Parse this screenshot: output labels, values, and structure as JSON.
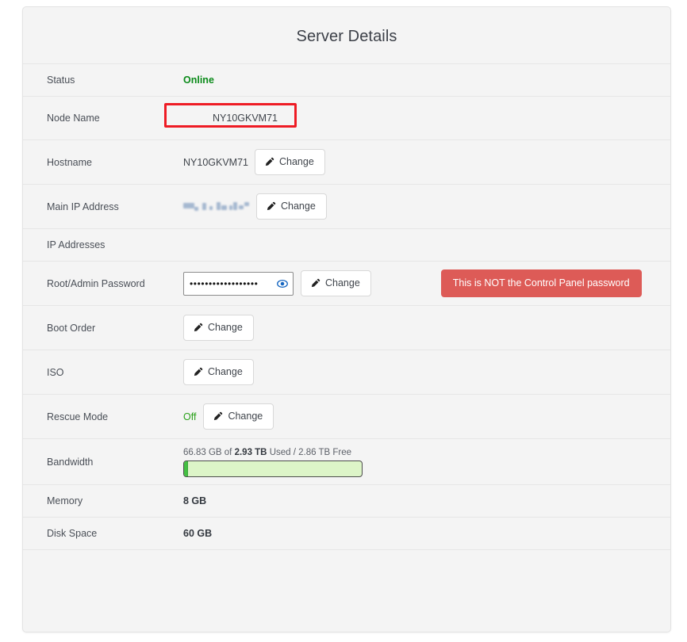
{
  "card": {
    "title": "Server Details"
  },
  "rows": {
    "status": {
      "label": "Status",
      "value": "Online"
    },
    "node_name": {
      "label": "Node Name",
      "value": "NY10GKVM71"
    },
    "hostname": {
      "label": "Hostname",
      "value": "NY10GKVM71",
      "button": "Change"
    },
    "main_ip": {
      "label": "Main IP Address",
      "value": "",
      "button": "Change"
    },
    "ip_addresses": {
      "label": "IP Addresses",
      "value": ""
    },
    "root_password": {
      "label": "Root/Admin Password",
      "value": "••••••••••••••••••",
      "button": "Change",
      "warning": "This is NOT the Control Panel password"
    },
    "boot_order": {
      "label": "Boot Order",
      "button": "Change"
    },
    "iso": {
      "label": "ISO",
      "button": "Change"
    },
    "rescue_mode": {
      "label": "Rescue Mode",
      "value": "Off",
      "button": "Change"
    },
    "bandwidth": {
      "label": "Bandwidth",
      "used": "66.83 GB",
      "total": "2.93 TB",
      "free": "2.86 TB",
      "text_prefix": "66.83 GB of ",
      "text_bold": "2.93 TB",
      "text_suffix": " Used / 2.86 TB Free",
      "percent_used": 2.3
    },
    "memory": {
      "label": "Memory",
      "value": "8 GB"
    },
    "disk_space": {
      "label": "Disk Space",
      "value": "60 GB"
    }
  },
  "colors": {
    "status_online": "#0a8a19",
    "rescue_off": "#2aa11a",
    "warning_badge": "#dd5b57",
    "annotation_box": "#ee1b24",
    "bandwidth_fill": "#44c042",
    "bandwidth_track": "#ddf5c8",
    "card_background": "#f4f4f4"
  },
  "icons": {
    "pencil": "pencil-icon",
    "eye": "eye-icon"
  }
}
